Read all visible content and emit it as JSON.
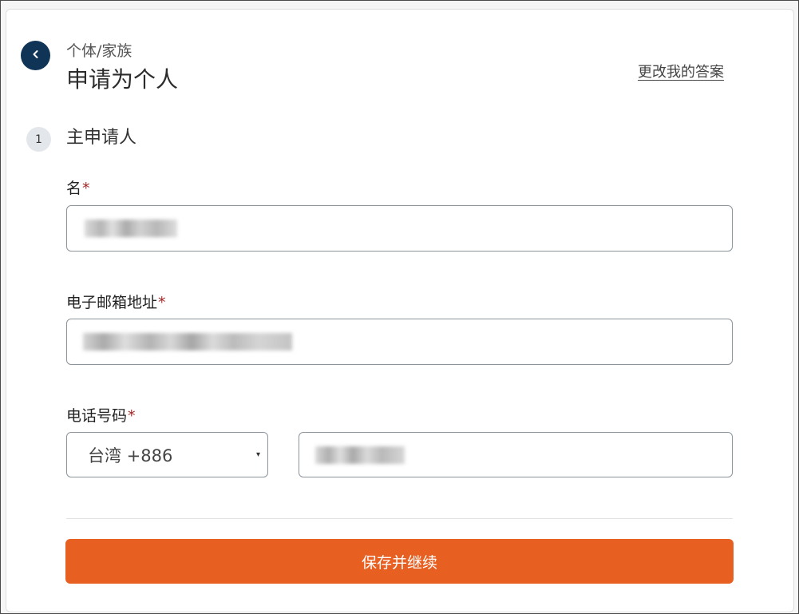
{
  "header": {
    "breadcrumb": "个体/家族",
    "title": "申请为个人",
    "change_answers_link": "更改我的答案",
    "back_icon": "chevron-left-icon"
  },
  "step": {
    "number": "1",
    "title": "主申请人"
  },
  "form": {
    "name_label": "名",
    "email_label": "电子邮箱地址",
    "phone_label": "电话号码",
    "required_mark": "*",
    "country_code_value": "台湾 +886",
    "dropdown_caret": "▾"
  },
  "submit_label": "保存并继续",
  "colors": {
    "accent": "#e85f22",
    "back_button": "#0f3456",
    "required": "#a32626"
  }
}
